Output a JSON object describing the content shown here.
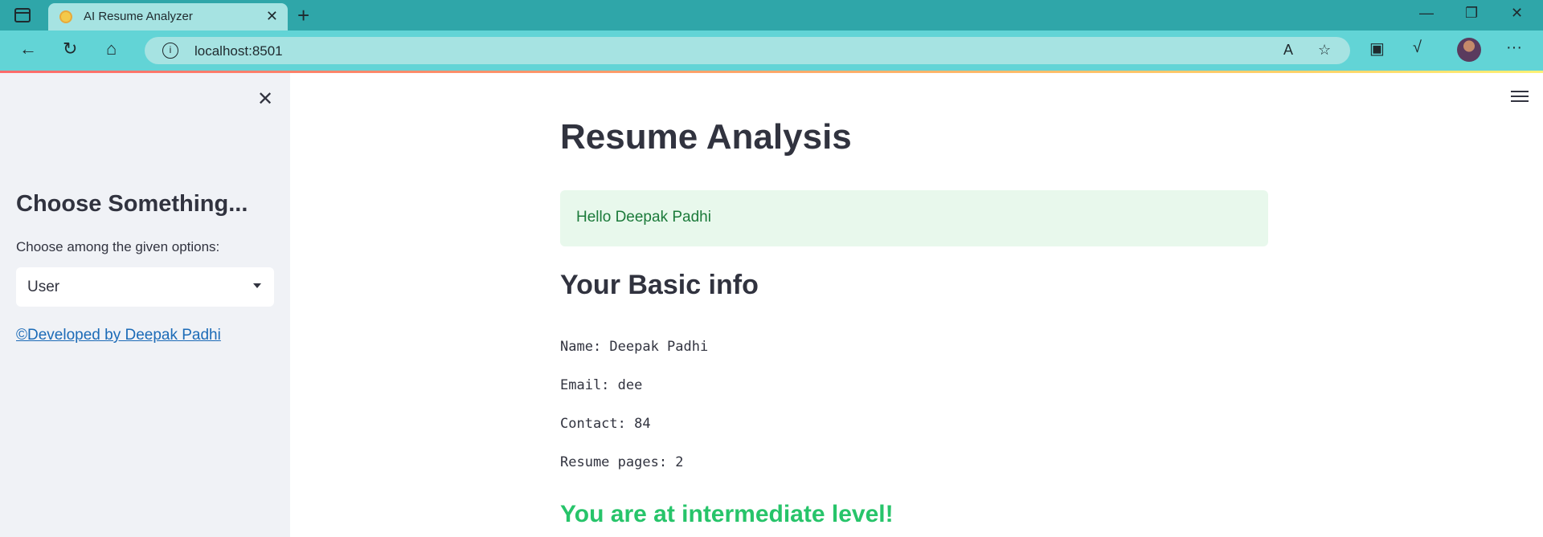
{
  "browser": {
    "tab_title": "AI Resume Analyzer",
    "tab_close": "✕",
    "new_tab": "+",
    "address": "localhost:8501",
    "address_info_icon": "i",
    "win_min": "—",
    "win_max": "❐",
    "win_close": "✕",
    "icons": {
      "back": "←",
      "reload": "↻",
      "home": "⌂",
      "read_aloud": "A",
      "favorite": "☆",
      "collections": "▣",
      "math": "√",
      "more": "···"
    }
  },
  "sidebar": {
    "close": "✕",
    "title": "Choose Something...",
    "label": "Choose among the given options:",
    "select_value": "User",
    "footer_link": "©Developed by Deepak Padhi"
  },
  "main": {
    "title": "Resume Analysis",
    "greeting": "Hello Deepak Padhi",
    "basic_info_title": "Your Basic info",
    "name_line": "Name: Deepak Padhi",
    "email_line": "Email: dee",
    "contact_line": "Contact: 84",
    "pages_line": "Resume pages: 2",
    "level": "You are at intermediate level!"
  },
  "colors": {
    "sidebar_bg": "#f0f2f6",
    "success_bg": "#e8f8ec",
    "success_text": "#1b7a3a",
    "level_text": "#27c46a",
    "link": "#1c6bb7",
    "tabbar": "#2fa6a9",
    "toolbar": "#62d4d6"
  }
}
